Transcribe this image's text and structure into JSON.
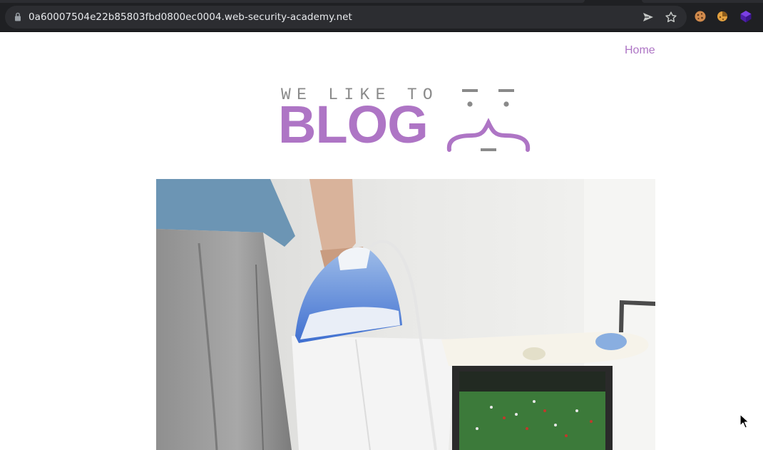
{
  "browser": {
    "url": "0a60007504e22b85803fbd0800ec0004.web-security-academy.net",
    "icons": [
      "lock-icon",
      "send-icon",
      "star-icon",
      "cookie-icon",
      "cookie-editor-icon",
      "extension-cube-icon"
    ]
  },
  "nav": {
    "home_label": "Home"
  },
  "logo": {
    "tagline": "WE LIKE TO",
    "word": "BLOG"
  },
  "hero": {
    "image": "person-ironing-shirt-with-football-on-tv"
  },
  "colors": {
    "accent": "#ae75c5",
    "chrome_bg": "#1f2023",
    "url_bg": "#2c2d31"
  }
}
